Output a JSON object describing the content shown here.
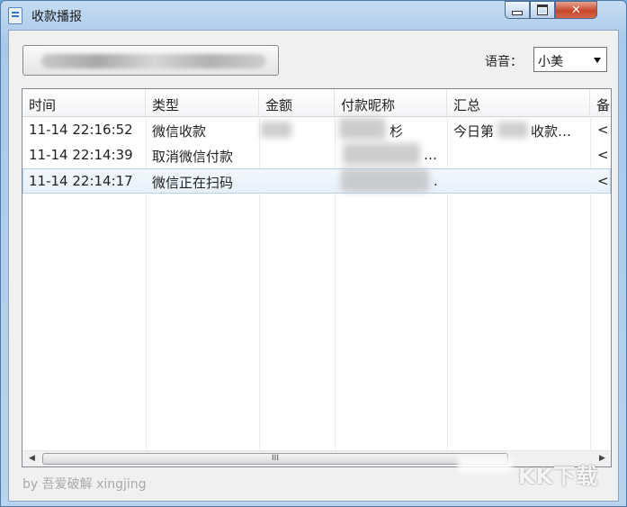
{
  "window": {
    "title": "收款播报"
  },
  "voice": {
    "label": "语音：",
    "selected": "小美"
  },
  "table": {
    "headers": [
      "时间",
      "类型",
      "金额",
      "付款昵称",
      "汇总",
      "备"
    ],
    "rows": [
      {
        "time": "11-14 22:16:52",
        "type": "微信收款",
        "nick": "杉",
        "summary": "今日第",
        "summary2": "收款…",
        "extra": "<"
      },
      {
        "time": "11-14 22:14:39",
        "type": "取消微信付款",
        "nick": "…",
        "summary": "",
        "summary2": "",
        "extra": "<"
      },
      {
        "time": "11-14 22:14:17",
        "type": "微信正在扫码",
        "nick": ".",
        "summary": "",
        "summary2": "",
        "extra": "<"
      }
    ]
  },
  "scrollbar": {
    "grip": "III"
  },
  "footer": {
    "text": "by 吾爱破解 xingjing"
  },
  "watermark": {
    "text": "KK下载"
  }
}
